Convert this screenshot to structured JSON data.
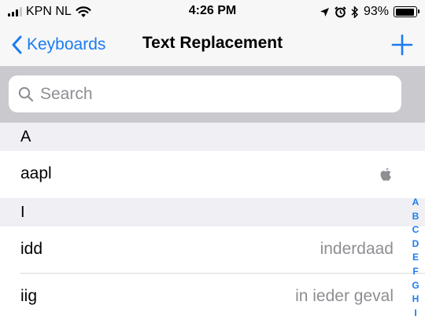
{
  "status_bar": {
    "carrier": "KPN NL",
    "time": "4:26 PM",
    "battery_percent_label": "93%",
    "battery_level": 0.93,
    "signal_bars_filled": 3,
    "signal_bars_total": 4
  },
  "nav": {
    "back_label": "Keyboards",
    "title": "Text Replacement",
    "accent_color": "#1b7cf3"
  },
  "search": {
    "placeholder": "Search",
    "value": ""
  },
  "sections": [
    {
      "header": "A",
      "rows": [
        {
          "shortcut": "aapl",
          "phrase": "",
          "phrase_icon": "apple-logo-icon"
        }
      ]
    },
    {
      "header": "I",
      "rows": [
        {
          "shortcut": "idd",
          "phrase": "inderdaad"
        },
        {
          "shortcut": "iig",
          "phrase": "in ieder geval"
        }
      ]
    }
  ],
  "section_index": [
    "A",
    "B",
    "C",
    "D",
    "E",
    "F",
    "G",
    "H",
    "I"
  ]
}
